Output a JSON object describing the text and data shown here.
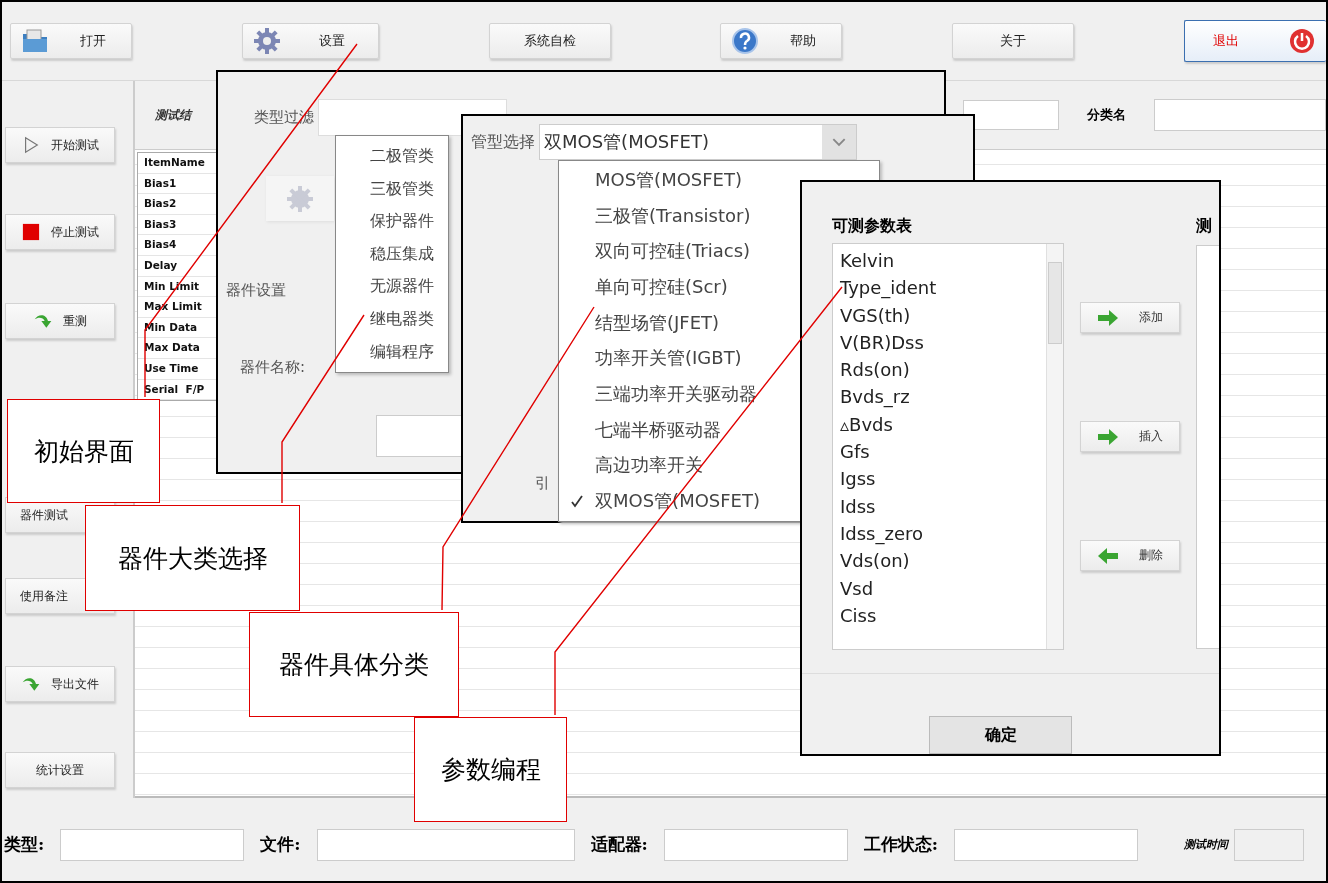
{
  "toolbar": [
    {
      "label": "打开"
    },
    {
      "label": "设置"
    },
    {
      "label": "系统自检"
    },
    {
      "label": "帮助"
    },
    {
      "label": "关于"
    },
    {
      "label": "退出"
    }
  ],
  "sidebar": [
    {
      "label": "开始测试"
    },
    {
      "label": "停止测试"
    },
    {
      "label": "重测"
    },
    {
      "label": "器件测试"
    },
    {
      "label": "使用备注"
    },
    {
      "label": "导出文件"
    },
    {
      "label": "统计设置"
    }
  ],
  "results": {
    "title": "测试结",
    "rows": [
      "ItemName",
      "Bias1",
      "Bias2",
      "Bias3",
      "Bias4",
      "Delay",
      "Min Limit",
      "Max Limit",
      "Min Data",
      "Max Data",
      "Use Time",
      "Serial  F/P"
    ]
  },
  "class_filter": {
    "label": "分类名"
  },
  "status_bar": [
    {
      "label": "类型:",
      "kind": "field"
    },
    {
      "label": "文件:",
      "kind": "field"
    },
    {
      "label": "适配器:",
      "kind": "field"
    },
    {
      "label": "工作状态:",
      "kind": "field"
    },
    {
      "label": "测试时间",
      "kind": "time"
    }
  ],
  "type_dialog": {
    "filter_label": "类型过滤",
    "items": [
      "二极管类",
      "三极管类",
      "保护器件",
      "稳压集成",
      "无源器件",
      "继电器类",
      "编辑程序"
    ],
    "section": "器件设置",
    "name_label": "器件名称:"
  },
  "model_dialog": {
    "label": "管型选择",
    "value": "双MOS管(MOSFET)",
    "pin_label": "引",
    "options": [
      {
        "label": "MOS管(MOSFET)",
        "checked": false
      },
      {
        "label": "三极管(Transistor)",
        "checked": false
      },
      {
        "label": "双向可控硅(Triacs)",
        "checked": false
      },
      {
        "label": "单向可控硅(Scr)",
        "checked": false
      },
      {
        "label": "结型场管(JFET)",
        "checked": false
      },
      {
        "label": "功率开关管(IGBT)",
        "checked": false
      },
      {
        "label": "三端功率开关驱动器",
        "checked": false
      },
      {
        "label": "七端半桥驱动器",
        "checked": false
      },
      {
        "label": "高边功率开关",
        "checked": false
      },
      {
        "label": "双MOS管(MOSFET)",
        "checked": true
      }
    ]
  },
  "param_dialog": {
    "title": "可测参数表",
    "params": [
      "Kelvin",
      "Type_ident",
      "VGS(th)",
      "V(BR)Dss",
      "Rds(on)",
      "Bvds_rz",
      "▵Bvds",
      "Gfs",
      "Igss",
      "Idss",
      "Idss_zero",
      "Vds(on)",
      "Vsd",
      "Ciss"
    ],
    "actions": [
      "添加",
      "插入",
      "删除"
    ],
    "test_label": "测",
    "ok": "确定"
  },
  "callouts": [
    "初始界面",
    "器件大类选择",
    "器件具体分类",
    "参数编程"
  ]
}
